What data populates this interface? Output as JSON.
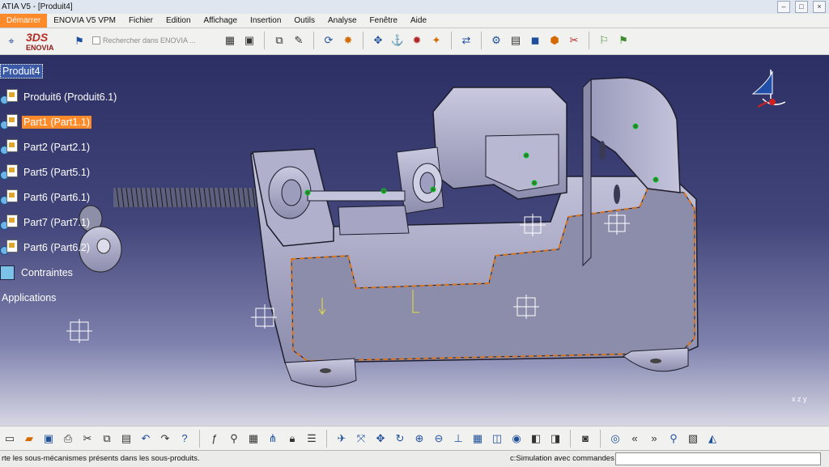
{
  "window": {
    "title": "ATIA V5 - [Produit4]",
    "buttons": [
      "–",
      "□",
      "×"
    ]
  },
  "menu": {
    "items": [
      "Démarrer",
      "ENOVIA V5 VPM",
      "Fichier",
      "Edition",
      "Affichage",
      "Insertion",
      "Outils",
      "Analyse",
      "Fenêtre",
      "Aide"
    ]
  },
  "toolbar": {
    "logo_text": "ENOVIA",
    "search_label": "Rechercher dans ENOVIA ..."
  },
  "tree": {
    "root": "Produit4",
    "items": [
      "Produit6 (Produit6.1)",
      "Part1 (Part1.1)",
      "Part2 (Part2.1)",
      "Part5 (Part5.1)",
      "Part6 (Part6.1)",
      "Part7 (Part7.1)",
      "Part6 (Part6.2)"
    ],
    "selected_index": 1,
    "constraints": "Contraintes",
    "applications": "Applications"
  },
  "triad": {
    "x": "x",
    "y": "y",
    "z": "z"
  },
  "status": {
    "message": "rte les sous-mécanismes présents dans les sous-produits.",
    "command_label": "c:Simulation avec commandes",
    "command_value": ""
  },
  "colors": {
    "selection": "#ff8a2a",
    "viewport_top": "#2c2f63",
    "model_fill": "#a9a9c8",
    "constraint_dash": "#d9741e"
  }
}
